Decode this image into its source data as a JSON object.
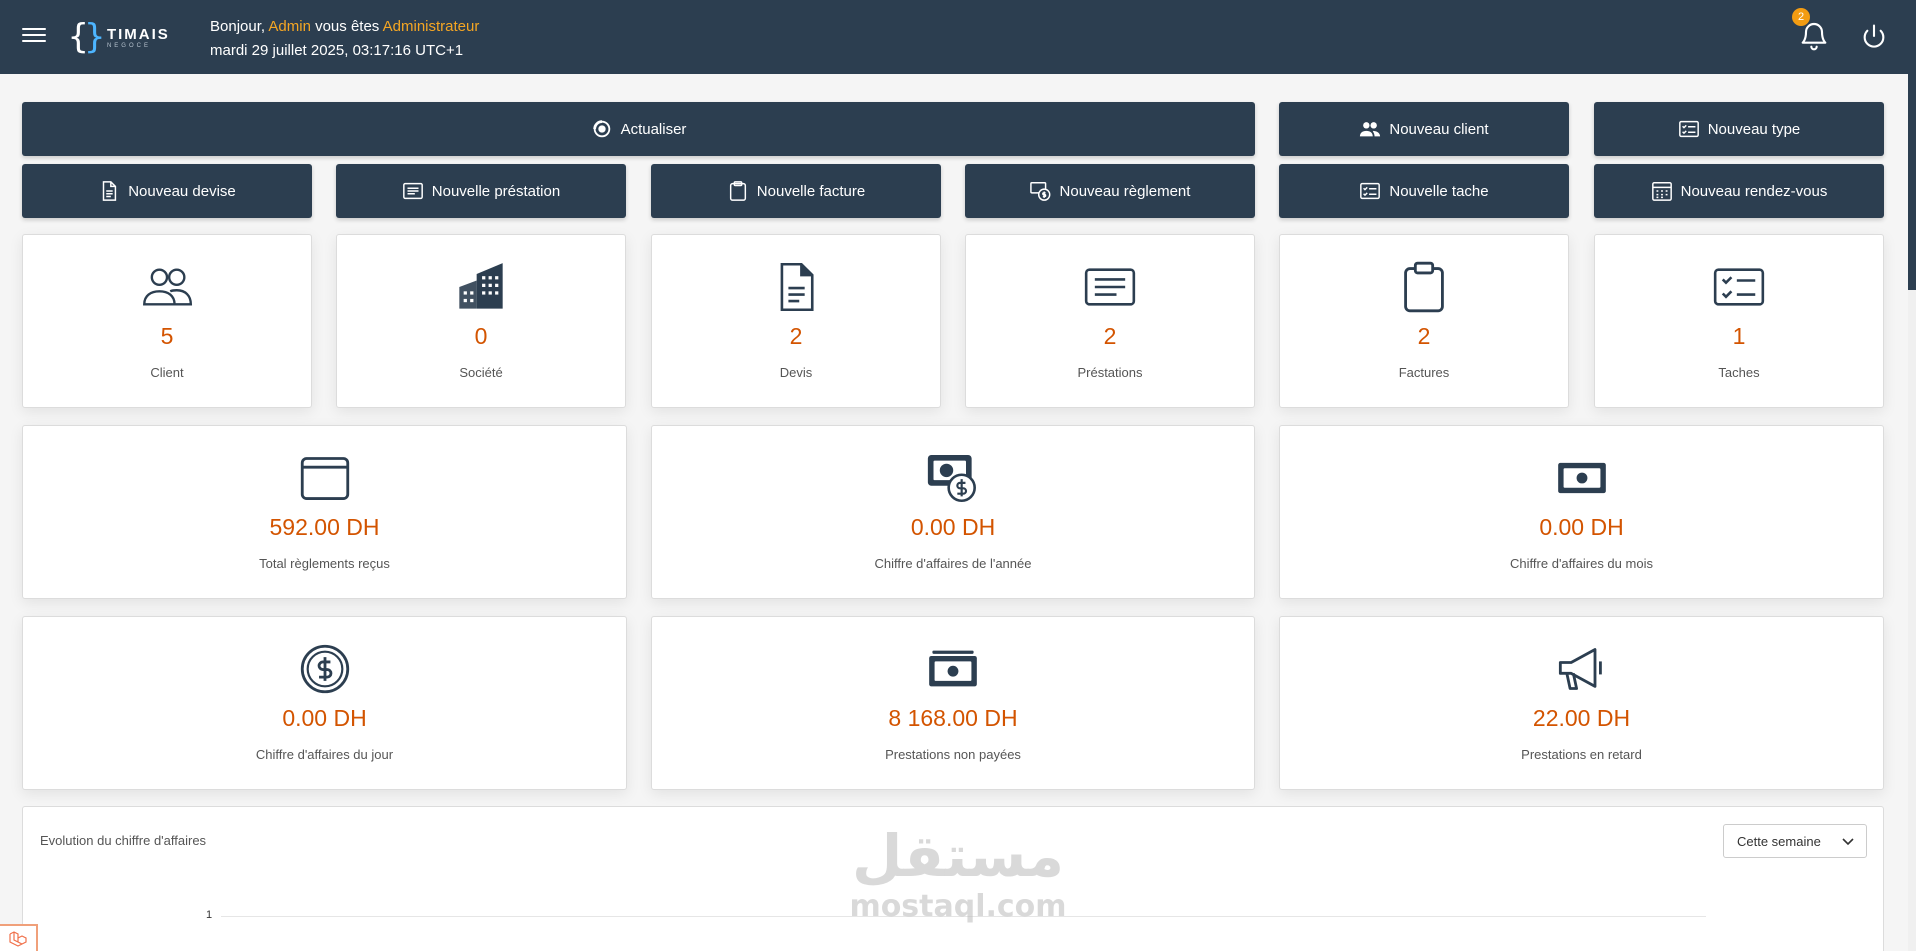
{
  "header": {
    "logo_main": "TIMAIS",
    "logo_sub": "NEGOCE",
    "greeting_prefix": "Bonjour, ",
    "user_name": "Admin",
    "greeting_mid": " vous êtes ",
    "user_role": "Administrateur",
    "datetime": "mardi 29 juillet 2025, 03:17:16 UTC+1",
    "notifications_count": "2"
  },
  "actions": {
    "refresh": "Actualiser",
    "new_client": "Nouveau client",
    "new_type": "Nouveau type",
    "new_quote": "Nouveau devise",
    "new_service": "Nouvelle préstation",
    "new_invoice": "Nouvelle facture",
    "new_payment": "Nouveau règlement",
    "new_task": "Nouvelle tache",
    "new_appointment": "Nouveau rendez-vous"
  },
  "counters": [
    {
      "value": "5",
      "label": "Client",
      "icon": "users-icon"
    },
    {
      "value": "0",
      "label": "Société",
      "icon": "building-icon"
    },
    {
      "value": "2",
      "label": "Devis",
      "icon": "document-icon"
    },
    {
      "value": "2",
      "label": "Préstations",
      "icon": "list-icon"
    },
    {
      "value": "2",
      "label": "Factures",
      "icon": "clipboard-icon"
    },
    {
      "value": "1",
      "label": "Taches",
      "icon": "checklist-icon"
    }
  ],
  "finance": [
    {
      "value": "592.00 DH",
      "label": "Total règlements reçus",
      "icon": "wallet-icon"
    },
    {
      "value": "0.00 DH",
      "label": "Chiffre d'affaires de l'année",
      "icon": "money-coin-icon"
    },
    {
      "value": "0.00 DH",
      "label": "Chiffre d'affaires du mois",
      "icon": "banknote-icon"
    },
    {
      "value": "0.00 DH",
      "label": "Chiffre d'affaires du jour",
      "icon": "dollar-coin-icon"
    },
    {
      "value": "8 168.00 DH",
      "label": "Prestations non payées",
      "icon": "cash-icon"
    },
    {
      "value": "22.00 DH",
      "label": "Prestations en retard",
      "icon": "megaphone-icon"
    }
  ],
  "chart": {
    "title": "Evolution du chiffre d'affaires",
    "period_selected": "Cette semaine",
    "y_tick": "1"
  },
  "chart_data": {
    "type": "line",
    "title": "Evolution du chiffre d'affaires",
    "y_ticks": [
      "1"
    ],
    "series": []
  },
  "watermark": {
    "arabic": "مستقل",
    "latin": "mostaql.com"
  },
  "colors": {
    "header_bg": "#2c3e50",
    "accent": "#d35400",
    "highlight": "#f5a623"
  }
}
